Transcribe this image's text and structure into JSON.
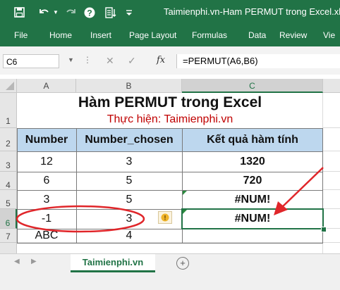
{
  "window": {
    "title": "Taimienphi.vn-Ham PERMUT trong Excel.xls"
  },
  "quick_access": {
    "save_icon": "save-icon",
    "undo_icon": "undo-icon",
    "redo_icon": "redo-icon",
    "help_icon": "help-icon",
    "sort_icon": "sort-icon"
  },
  "ribbon": {
    "tabs": [
      "File",
      "Home",
      "Insert",
      "Page Layout",
      "Formulas",
      "Data",
      "Review",
      "Vie"
    ]
  },
  "formula_bar": {
    "name_box": "C6",
    "fx_label": "fx",
    "formula": "=PERMUT(A6,B6)"
  },
  "sheet": {
    "columns": [
      "A",
      "B",
      "C"
    ],
    "rows": [
      "1",
      "2",
      "3",
      "4",
      "5",
      "6",
      "7"
    ],
    "selected_cell": "C6",
    "title": "Hàm PERMUT trong Excel",
    "subtitle": "Thực hiện: Taimienphi.vn",
    "headers": [
      "Number",
      "Number_chosen",
      "Kết quả hàm tính"
    ],
    "data": [
      [
        "12",
        "3",
        "1320"
      ],
      [
        "6",
        "5",
        "720"
      ],
      [
        "3",
        "5",
        "#NUM!"
      ],
      [
        "-1",
        "3",
        "#NUM!"
      ],
      [
        "ABC",
        "4",
        ""
      ]
    ],
    "colors": {
      "header_fill": "#bdd7ee",
      "subtitle": "#c00000",
      "annotation": "#e0262a",
      "excel_green": "#217346"
    }
  },
  "sheet_tabs": {
    "active": "Taimienphi.vn",
    "add_label": "+"
  }
}
